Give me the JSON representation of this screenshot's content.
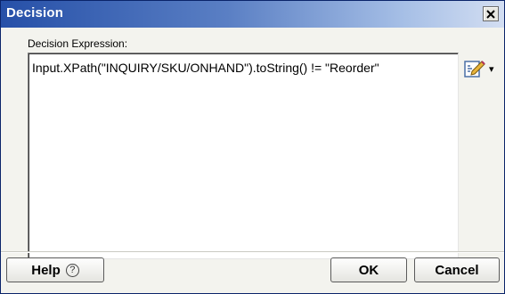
{
  "window": {
    "title": "Decision",
    "close_glyph": "×"
  },
  "form": {
    "expression_label": "Decision Expression:",
    "expression_value": "Input.XPath(\"INQUIRY/SKU/ONHAND\").toString() != \"Reorder\""
  },
  "editor_button": {
    "icon": "edit-expression-icon",
    "arrow": "▾"
  },
  "buttons": {
    "help_label": "Help",
    "help_icon_glyph": "?",
    "ok_label": "OK",
    "cancel_label": "Cancel"
  },
  "colors": {
    "title_bar_start": "#2650a8",
    "title_bar_end": "#d3def2",
    "dialog_bg": "#f3f3ee"
  }
}
